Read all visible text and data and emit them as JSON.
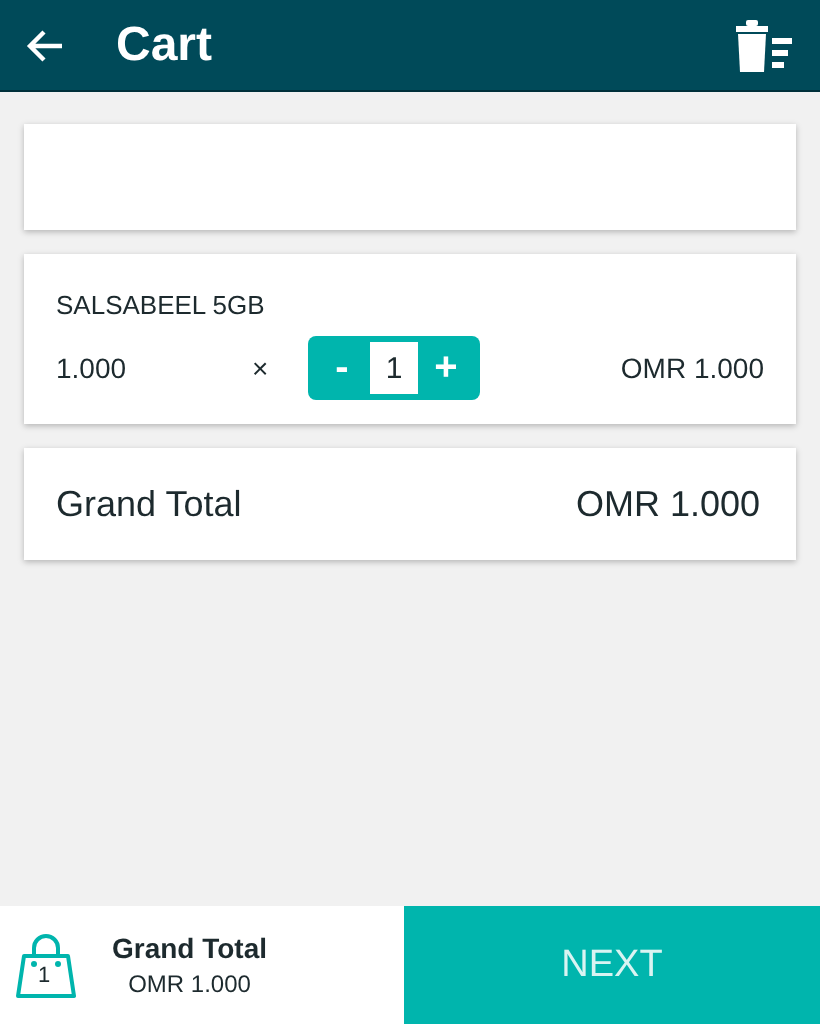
{
  "header": {
    "title": "Cart"
  },
  "items": [
    {
      "name": "SALSABEEL 5GB",
      "price": "1.000",
      "times": "×",
      "decrement": "-",
      "quantity": "1",
      "increment": "+",
      "subtotal": "OMR 1.000"
    }
  ],
  "summary": {
    "label": "Grand Total",
    "value": "OMR 1.000"
  },
  "footer": {
    "bag_count": "1",
    "label": "Grand Total",
    "value": "OMR 1.000",
    "next": "NEXT"
  }
}
